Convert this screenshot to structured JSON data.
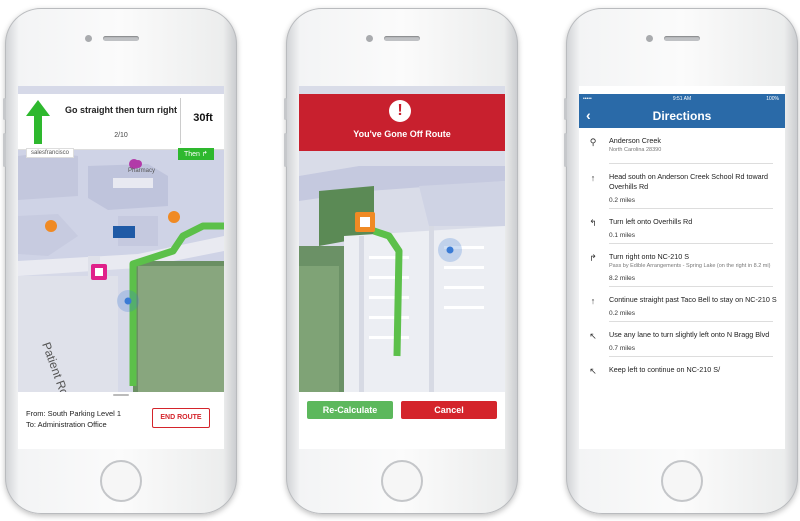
{
  "colors": {
    "route_green": "#5cc04a",
    "alert_red": "#c8202e",
    "header_blue": "#2a6aa8",
    "position_blue": "#3a7bd5"
  },
  "phone1": {
    "instruction": "Go straight then turn right",
    "step": "2/10",
    "distance": "30ft",
    "map_label": "salesfrancisco",
    "then_label": "Then",
    "map_room_label": "Pharmacy",
    "street_label": "Patient Ro",
    "from": "From: South Parking Level 1",
    "to": "To: Administration Office",
    "end_route": "END ROUTE"
  },
  "phone2": {
    "alert_title": "You've Gone Off Route",
    "recalculate": "Re-Calculate",
    "cancel": "Cancel"
  },
  "phone3": {
    "status_left": "•••••",
    "status_time": "9:51 AM",
    "status_right": "100%",
    "title": "Directions",
    "steps": [
      {
        "icon": "location-pin-icon",
        "glyph": "⚲",
        "text": "Anderson Creek",
        "sub": "North Carolina 28390",
        "distance": ""
      },
      {
        "icon": "arrow-up-icon",
        "glyph": "↑",
        "text": "Head south on Anderson Creek School Rd toward Overhills Rd",
        "sub": "",
        "distance": "0.2 miles"
      },
      {
        "icon": "turn-left-icon",
        "glyph": "↰",
        "text": "Turn left onto Overhills Rd",
        "sub": "",
        "distance": "0.1 miles"
      },
      {
        "icon": "turn-right-icon",
        "glyph": "↱",
        "text": "Turn right onto NC-210 S",
        "sub": "Pass by Edible Arrangements - Spring Lake (on the right in 8.2 mi)",
        "distance": "8.2 miles"
      },
      {
        "icon": "arrow-up-icon",
        "glyph": "↑",
        "text": "Continue straight past Taco Bell to stay on NC-210 S",
        "sub": "",
        "distance": "0.2 miles"
      },
      {
        "icon": "slight-left-icon",
        "glyph": "↖",
        "text": "Use any lane to turn slightly left onto N Bragg Blvd",
        "sub": "",
        "distance": "0.7 miles"
      },
      {
        "icon": "keep-left-icon",
        "glyph": "↖",
        "text": "Keep left to continue on NC-210 S/",
        "sub": "",
        "distance": ""
      }
    ]
  }
}
